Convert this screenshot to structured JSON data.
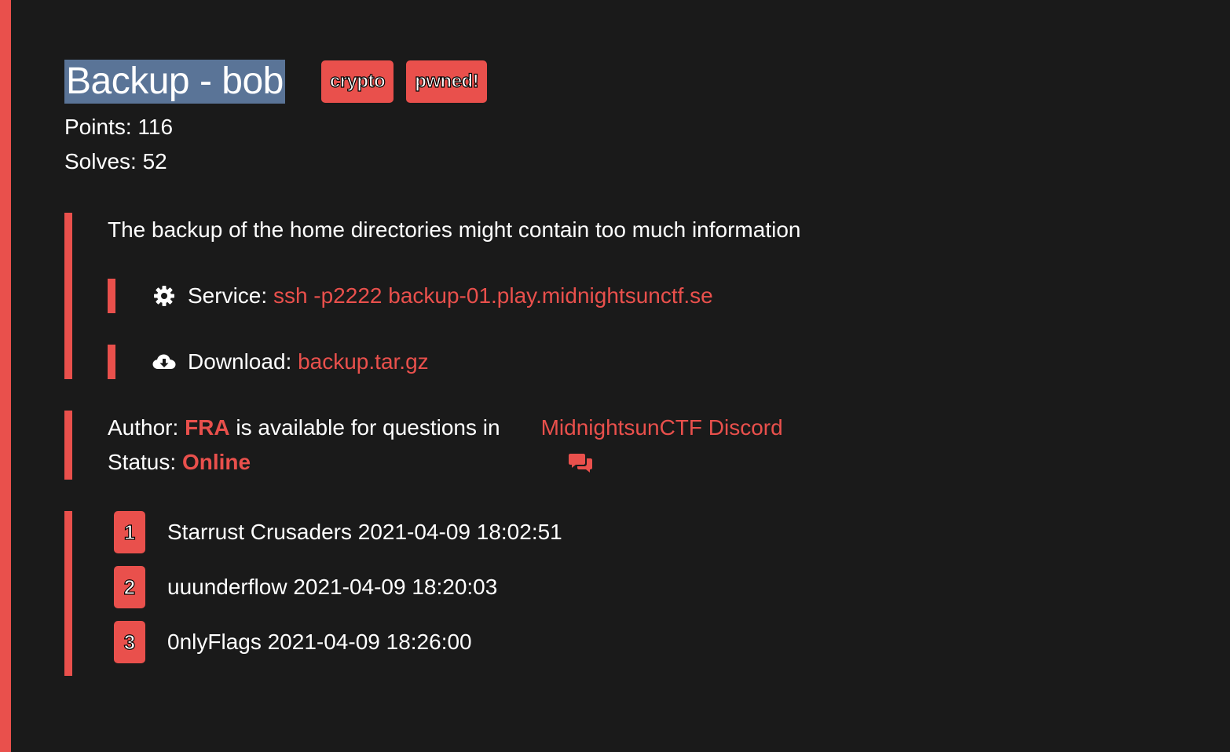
{
  "challenge": {
    "title": "Backup - bob",
    "tags": [
      "crypto",
      "pwned!"
    ],
    "points_label": "Points: 116",
    "solves_label": "Solves: 52",
    "description": "The backup of the home directories might contain too much information",
    "service": {
      "label": "Service: ",
      "value": "ssh -p2222 backup-01.play.midnightsunctf.se",
      "icon": "gear-icon"
    },
    "download": {
      "label": "Download: ",
      "value": "backup.tar.gz",
      "icon": "cloud-download-icon"
    }
  },
  "author": {
    "prefix": "Author: ",
    "name": "FRA",
    "middle": " is available for questions in",
    "chat_icon": "chat-icon",
    "discord_link": "MidnightsunCTF Discord",
    "status_label": "Status: ",
    "status_value": "Online"
  },
  "solves": [
    {
      "rank": "1",
      "text": "Starrust Crusaders 2021-04-09 18:02:51"
    },
    {
      "rank": "2",
      "text": "uuunderflow 2021-04-09 18:20:03"
    },
    {
      "rank": "3",
      "text": "0nlyFlags 2021-04-09 18:26:00"
    }
  ],
  "colors": {
    "accent": "#e9504c",
    "background": "#1a1a1a",
    "title_highlight": "#5a7497"
  }
}
